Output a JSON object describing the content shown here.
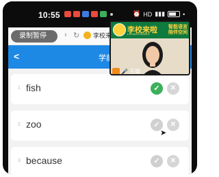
{
  "status_bar": {
    "time": "10:55",
    "signal_text": "HD"
  },
  "browser": {
    "record_label": "录制暂停",
    "site_label": "李校来"
  },
  "app_bar": {
    "title": "学前"
  },
  "video": {
    "brand_name": "李校来啦",
    "brand_en": "LIXIAOCOMING",
    "slogan_line1": "智能语言",
    "slogan_line2": "陪伴空间",
    "teacher_name": "王璐"
  },
  "words": [
    {
      "num": "1",
      "word": "fish",
      "marked_correct": true
    },
    {
      "num": "2",
      "word": "zoo",
      "marked_correct": false
    },
    {
      "num": "3",
      "word": "because",
      "marked_correct": false
    }
  ],
  "colors": {
    "header": "#1e88e5",
    "correct": "#3cb05a",
    "banner": "#0f7a3e",
    "brand_yellow": "#ffd23f"
  }
}
